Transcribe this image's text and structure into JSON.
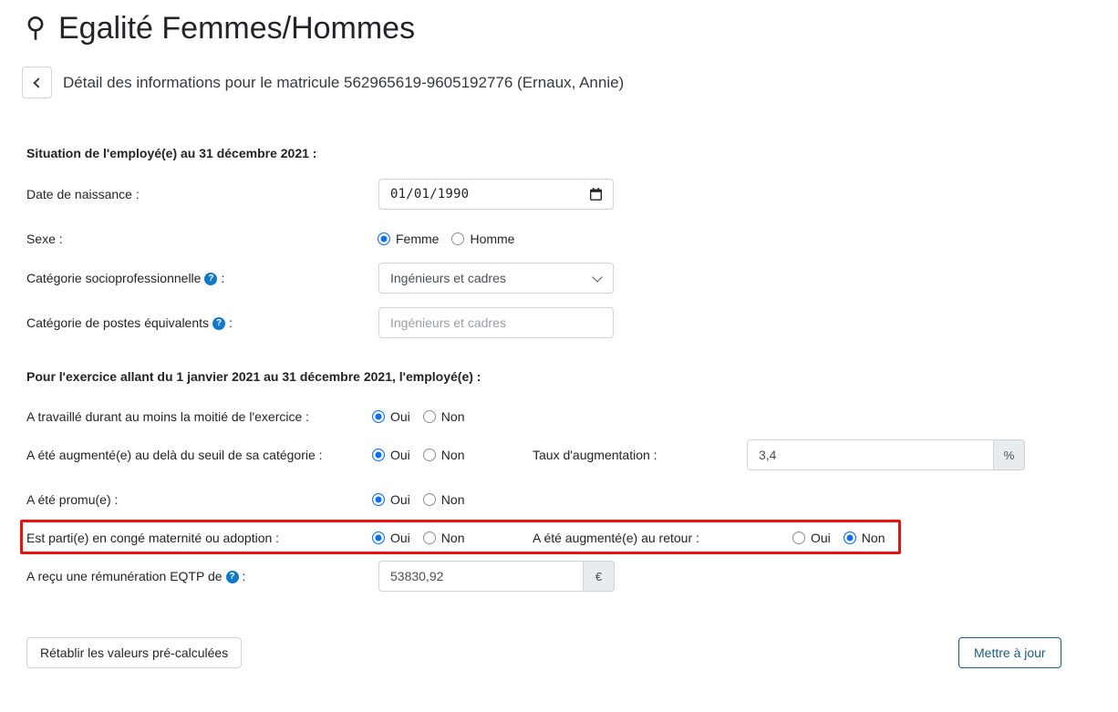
{
  "header": {
    "icon": "venus-mars-icon",
    "title": "Egalité Femmes/Hommes",
    "back_icon": "chevron-left-icon",
    "subtitle": "Détail des informations pour le matricule 562965619-9605192776 (Ernaux, Annie)"
  },
  "section1": {
    "title": "Situation de l'employé(e) au 31 décembre 2021 :",
    "birthdate": {
      "label": "Date de naissance :",
      "value": "01/01/1990",
      "icon": "calendar-icon"
    },
    "sex": {
      "label": "Sexe :",
      "options": [
        "Femme",
        "Homme"
      ],
      "selected": "Femme"
    },
    "socio_category": {
      "label_before": "Catégorie socioprofessionnelle",
      "label_after": ":",
      "help_icon": "help-circle-icon",
      "help_glyph": "?",
      "value": "Ingénieurs et cadres",
      "chevron_icon": "chevron-down-icon"
    },
    "equivalent_posts": {
      "label_before": "Catégorie de postes équivalents",
      "label_after": ":",
      "help_icon": "help-circle-icon",
      "help_glyph": "?",
      "placeholder": "Ingénieurs et cadres",
      "value": ""
    }
  },
  "section2": {
    "title": "Pour l'exercice allant du 1 janvier 2021 au 31 décembre 2021, l'employé(e) :",
    "worked_half": {
      "label": "A travaillé durant au moins la moitié de l'exercice :",
      "options": [
        "Oui",
        "Non"
      ],
      "selected": "Oui"
    },
    "raised_above_threshold": {
      "label": "A été augmenté(e) au delà du seuil de sa catégorie :",
      "options": [
        "Oui",
        "Non"
      ],
      "selected": "Oui"
    },
    "raise_rate": {
      "label": "Taux d'augmentation :",
      "value": "3,4",
      "unit": "%"
    },
    "promoted": {
      "label": "A été promu(e) :",
      "options": [
        "Oui",
        "Non"
      ],
      "selected": "Oui"
    },
    "maternity_leave": {
      "label": "Est parti(e) en congé maternité ou adoption :",
      "options": [
        "Oui",
        "Non"
      ],
      "selected": "Oui"
    },
    "raised_on_return": {
      "label": "A été augmenté(e) au retour :",
      "options": [
        "Oui",
        "Non"
      ],
      "selected": "Non"
    },
    "remuneration": {
      "label_before": "A reçu une rémunération EQTP de",
      "label_after": ":",
      "help_icon": "help-circle-icon",
      "help_glyph": "?",
      "value": "53830,92",
      "unit": "€"
    }
  },
  "actions": {
    "reset_label": "Rétablir les valeurs pré-calculées",
    "update_label": "Mettre à jour"
  },
  "colors": {
    "accent_blue": "#0d6efd",
    "help_blue": "#1279c6",
    "highlight_red": "#e8130e",
    "update_button": "#1d5c7f"
  }
}
